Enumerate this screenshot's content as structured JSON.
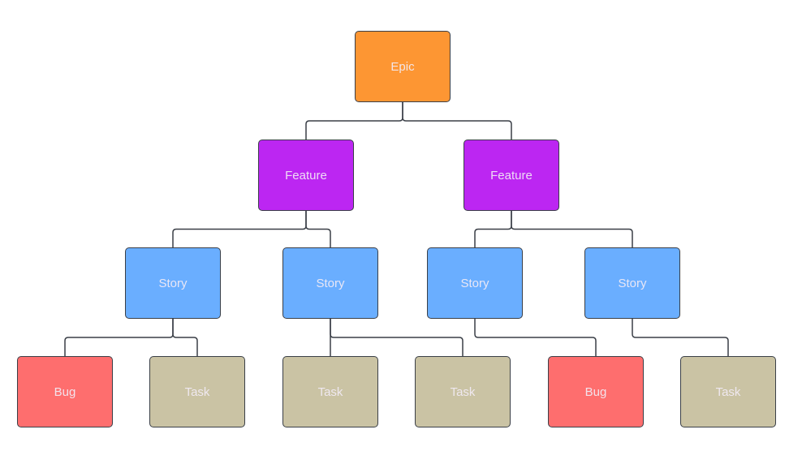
{
  "diagram": {
    "type": "hierarchy",
    "colors": {
      "epic": "#fd9633",
      "feature": "#bc26f2",
      "story": "#6aaeff",
      "bug": "#fe6e6e",
      "task": "#cac3a4",
      "connector": "#3a3f47",
      "label": "#f3ecf6"
    },
    "nodes": [
      {
        "id": "epic",
        "label": "Epic",
        "kind": "epic",
        "parent": null
      },
      {
        "id": "feature-1",
        "label": "Feature",
        "kind": "feature",
        "parent": "epic"
      },
      {
        "id": "feature-2",
        "label": "Feature",
        "kind": "feature",
        "parent": "epic"
      },
      {
        "id": "story-1",
        "label": "Story",
        "kind": "story",
        "parent": "feature-1"
      },
      {
        "id": "story-2",
        "label": "Story",
        "kind": "story",
        "parent": "feature-1"
      },
      {
        "id": "story-3",
        "label": "Story",
        "kind": "story",
        "parent": "feature-2"
      },
      {
        "id": "story-4",
        "label": "Story",
        "kind": "story",
        "parent": "feature-2"
      },
      {
        "id": "bug-1",
        "label": "Bug",
        "kind": "bug",
        "parent": "story-1"
      },
      {
        "id": "task-1",
        "label": "Task",
        "kind": "task",
        "parent": "story-1"
      },
      {
        "id": "task-2",
        "label": "Task",
        "kind": "task",
        "parent": "story-2"
      },
      {
        "id": "task-3",
        "label": "Task",
        "kind": "task",
        "parent": "story-2"
      },
      {
        "id": "bug-2",
        "label": "Bug",
        "kind": "bug",
        "parent": "story-3"
      },
      {
        "id": "task-4",
        "label": "Task",
        "kind": "task",
        "parent": "story-4"
      }
    ]
  }
}
